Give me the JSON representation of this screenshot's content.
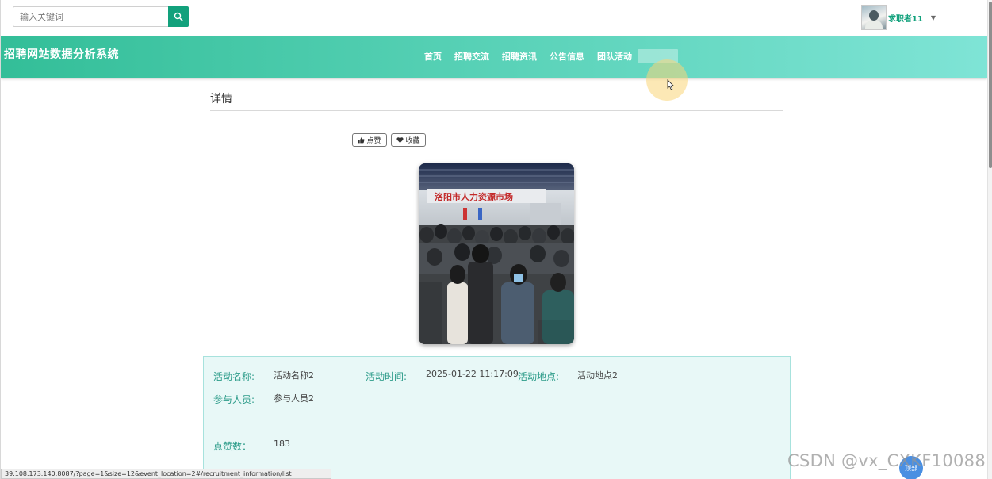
{
  "search": {
    "placeholder": "输入关键词",
    "button_icon": "search-icon"
  },
  "user": {
    "name": "求职者11",
    "avatar_icon": "user-avatar",
    "menu_icon": "caret-down-icon"
  },
  "header": {
    "site_title": "招聘网站数据分析系统"
  },
  "nav": {
    "items": [
      "首页",
      "招聘交流",
      "招聘资讯",
      "公告信息",
      "团队活动"
    ]
  },
  "detail": {
    "title": "详情",
    "like_label": "点赞",
    "favorite_label": "收藏",
    "photo_banner": "洛阳市人力资源市场",
    "fields": {
      "activity_name_label": "活动名称:",
      "activity_name_value": "活动名称2",
      "activity_time_label": "活动时间:",
      "activity_time_value": "2025-01-22 11:17:09",
      "activity_place_label": "活动地点:",
      "activity_place_value": "活动地点2",
      "participants_label": "参与人员:",
      "participants_value": "参与人员2",
      "likes_label": "点赞数：",
      "likes_value": "183"
    }
  },
  "status_bar": {
    "url": "39.108.173.140:8087/?page=1&size=12&event_location=2#/recruitment_information/list"
  },
  "watermark": "CSDN @vx_CXKF10088",
  "fab": {
    "label": "顶部"
  },
  "colors": {
    "brand": "#12a17c",
    "header_start": "#33be98",
    "header_end": "#7fe4d6",
    "label": "#2d9c8a"
  }
}
